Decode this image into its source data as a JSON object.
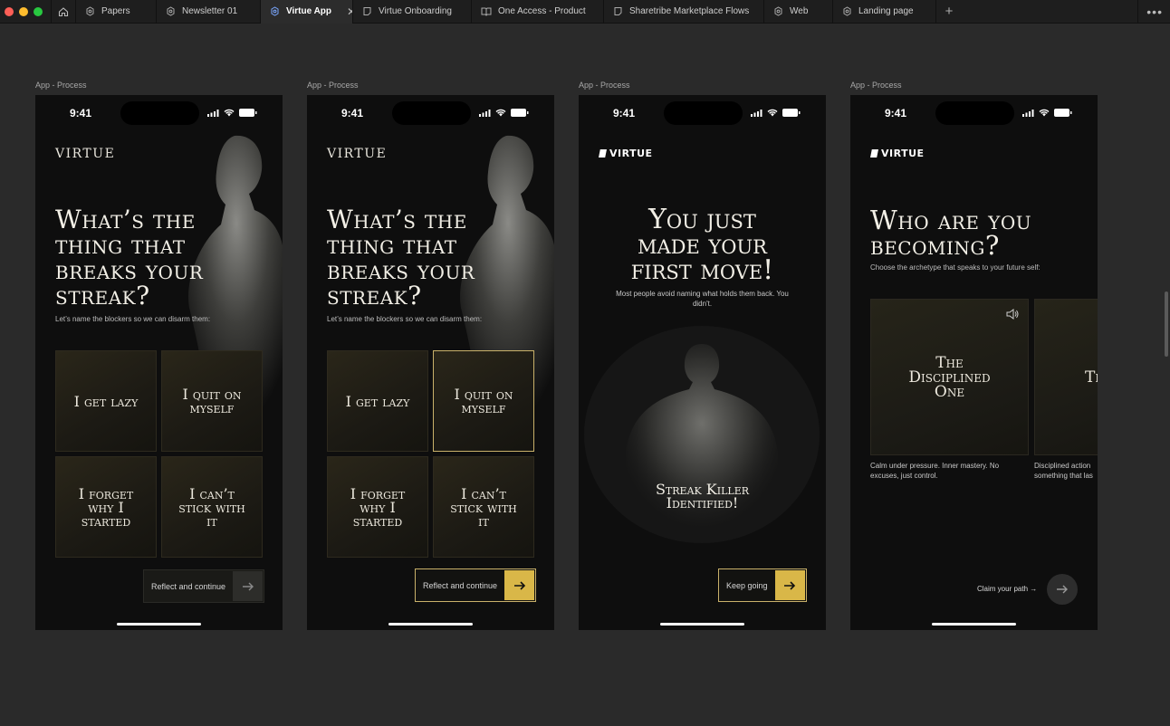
{
  "window": {
    "traffic_colors": [
      "#fe5f57",
      "#febc2e",
      "#28c840"
    ]
  },
  "tabs": [
    {
      "label": "Papers",
      "icon": "figma-file-icon"
    },
    {
      "label": "Newsletter 01",
      "icon": "figma-file-icon"
    },
    {
      "label": "Virtue App",
      "icon": "figma-file-icon",
      "active": true
    },
    {
      "label": "Virtue Onboarding",
      "icon": "figjam-file-icon"
    },
    {
      "label": "One Access - Product",
      "icon": "book-icon"
    },
    {
      "label": "Sharetribe Marketplace Flows",
      "icon": "figjam-file-icon"
    },
    {
      "label": "Web",
      "icon": "figma-file-icon"
    },
    {
      "label": "Landing page",
      "icon": "figma-file-icon"
    }
  ],
  "frames": [
    {
      "label": "App - Process",
      "time": "9:41",
      "logo": "VIRTUE",
      "headline": [
        "What’s the",
        "thing that",
        "breaks your",
        "streak?"
      ],
      "subtitle": "Let’s name the blockers so we can disarm them:",
      "options": [
        "I get lazy",
        "I quit on myself",
        "I forget why I started",
        "I can’t stick with it"
      ],
      "cta": "Reflect and continue"
    },
    {
      "label": "App - Process",
      "time": "9:41",
      "logo": "VIRTUE",
      "headline": [
        "What’s the",
        "thing that",
        "breaks your",
        "streak?"
      ],
      "subtitle": "Let’s name the blockers so we can disarm them:",
      "options": [
        "I get lazy",
        "I quit on myself",
        "I forget why I started",
        "I can’t stick with it"
      ],
      "selected_index": 1,
      "cta": "Reflect and continue"
    },
    {
      "label": "App - Process",
      "time": "9:41",
      "logo": "VIRTUE",
      "headline": [
        "You just",
        "made your",
        "first move!"
      ],
      "subtitle": "Most people avoid naming what holds them back. You didn't.",
      "result": "Streak Killer Identified!",
      "cta": "Keep going"
    },
    {
      "label": "App - Process",
      "time": "9:41",
      "logo": "VIRTUE",
      "headline": [
        "Who are you",
        "becoming?"
      ],
      "subtitle": "Choose the archetype that speaks to your future self:",
      "archetypes": [
        {
          "title": "The Disciplined One",
          "desc": [
            "Calm under pressure. Inner mastery. No",
            "excuses, just control."
          ]
        },
        {
          "title": "The",
          "desc": [
            "Disciplined action",
            "something that las"
          ]
        }
      ],
      "cta": "Claim your path →"
    }
  ],
  "colors": {
    "accent_gold": "#d9b748",
    "gold_border": "#c9b16a"
  }
}
